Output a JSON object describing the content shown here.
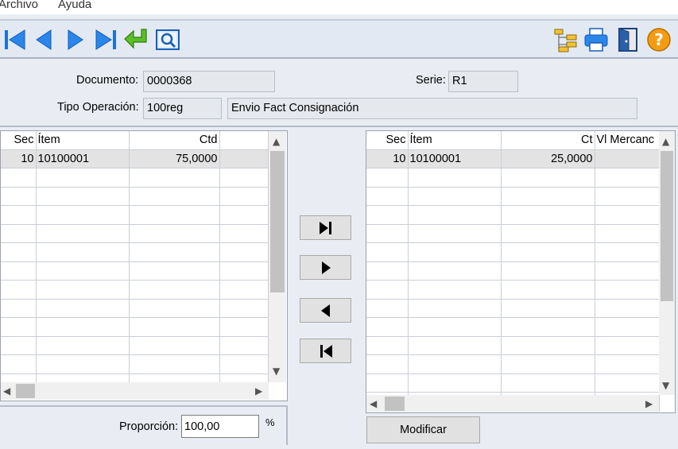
{
  "menu": {
    "items": [
      "Archivo",
      "Ayuda"
    ]
  },
  "toolbar": {
    "left_icons": [
      "first-record-icon",
      "previous-record-icon",
      "next-record-icon",
      "last-record-icon",
      "accept-icon",
      "preview-icon"
    ],
    "right_icons": [
      "tree-structure-icon",
      "print-icon",
      "exit-door-icon",
      "help-icon"
    ]
  },
  "header": {
    "documento_label": "Documento:",
    "documento_value": "0000368",
    "serie_label": "Serie:",
    "serie_value": "R1",
    "tipo_label": "Tipo Operación:",
    "tipo_code": "100reg",
    "tipo_desc": "Envio Fact Consignación"
  },
  "left_grid": {
    "columns": [
      "Sec",
      "Ítem",
      "Ctd",
      ""
    ],
    "rows": [
      [
        "10",
        "10100001",
        "75,0000",
        ""
      ]
    ]
  },
  "right_grid": {
    "columns": [
      "Sec",
      "Ítem",
      "Ct",
      "Vl Mercanc"
    ],
    "rows": [
      [
        "10",
        "10100001",
        "25,0000",
        ""
      ]
    ]
  },
  "move_buttons": [
    "move-all-right-icon",
    "move-right-icon",
    "move-left-icon",
    "move-all-left-icon"
  ],
  "proportion": {
    "label": "Proporción:",
    "value": "100,00",
    "unit": "%"
  },
  "modify_button": {
    "label": "Modificar"
  },
  "colors": {
    "toolbar_blue": "#1a73d8",
    "accept_green": "#3a9a1e",
    "help_orange": "#f39c12",
    "selected_row": "#e3e3e3"
  }
}
